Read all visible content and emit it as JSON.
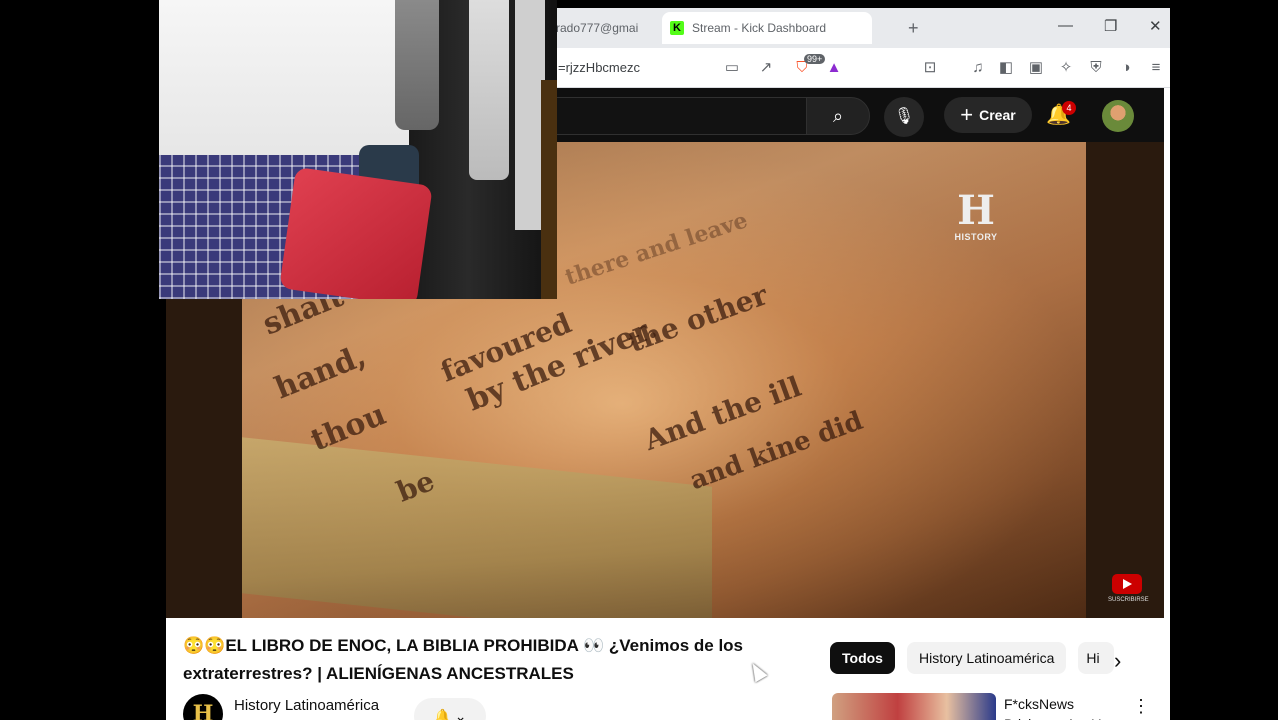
{
  "browser": {
    "tabs": [
      {
        "label": "rado777@gmai"
      },
      {
        "label": "Stream - Kick Dashboard",
        "favicon": "K"
      }
    ],
    "new_tab": "+",
    "window_controls": [
      "—",
      "❐",
      "✕"
    ],
    "url": "=rjzzHbcmezc",
    "brave_badge_count": "99+"
  },
  "youtube": {
    "create_label": "Crear",
    "notification_count": "4",
    "video": {
      "logo_letter": "H",
      "logo_text": "HISTORY",
      "subscribe_watermark": "SUSCRIBIRSE",
      "page_lines": [
        "shalt",
        "hand,",
        "thou",
        "favoured",
        "by the river.",
        "the other",
        "And the ill",
        "and kine did",
        "there and leave",
        "be"
      ]
    },
    "title": "😳😳EL LIBRO DE ENOC, LA BIBLIA PROHIBIDA 👀 ¿Venimos de los extraterrestres? | ALIENÍGENAS ANCESTRALES",
    "channel": {
      "name": "History Latinoamérica",
      "avatar_letter": "H"
    },
    "subscribe_bell": "🔔 ⌄",
    "chips": [
      "Todos",
      "History Latinoamérica",
      "Hi"
    ],
    "recommended": {
      "title": "F*cksNews Brisbane: Are Ye"
    }
  },
  "colors": {
    "kick_green": "#53fc18",
    "yt_red": "#cc0000",
    "dark": "#0f0f0f"
  }
}
